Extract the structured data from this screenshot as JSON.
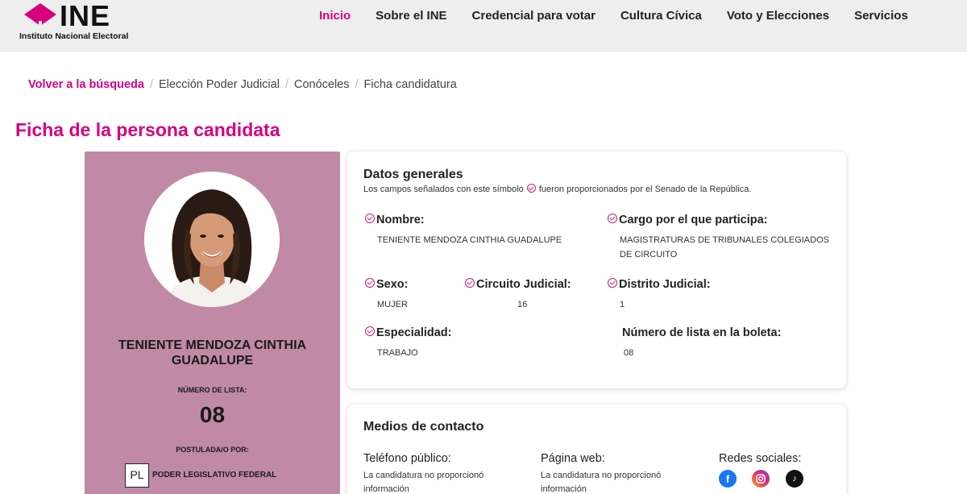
{
  "header": {
    "logo_text": "INE",
    "logo_subtitle": "Instituto Nacional Electoral",
    "nav": [
      "Inicio",
      "Sobre el INE",
      "Credencial para votar",
      "Cultura Cívica",
      "Voto y Elecciones",
      "Servicios"
    ],
    "active_nav": "Inicio"
  },
  "breadcrumb": {
    "back": "Volver a la búsqueda",
    "items": [
      "Elección Poder Judicial",
      "Conóceles",
      "Ficha candidatura"
    ],
    "separator": "/"
  },
  "page_title": "Ficha de la persona candidata",
  "candidate": {
    "name": "TENIENTE MENDOZA CINTHIA GUADALUPE",
    "list_label": "NÚMERO DE LISTA:",
    "list_number": "08",
    "postulated_label": "POSTULADA/O POR:",
    "postulated_code": "PL",
    "postulated_by": "PODER LEGISLATIVO FEDERAL",
    "card_color": "#c08aa7"
  },
  "datos_generales": {
    "title": "Datos generales",
    "note_before": "Los campos señalados con este símbolo",
    "note_after": "fueron proporcionados por el Senado de la República.",
    "nombre_label": "Nombre:",
    "nombre_value": "TENIENTE MENDOZA CINTHIA GUADALUPE",
    "cargo_label": "Cargo por el que participa:",
    "cargo_value": "MAGISTRATURAS DE TRIBUNALES COLEGIADOS DE CIRCUITO",
    "sexo_label": "Sexo:",
    "sexo_value": "MUJER",
    "circuito_label": "Circuito Judicial:",
    "circuito_value": "16",
    "distrito_label": "Distrito Judicial:",
    "distrito_value": "1",
    "especialidad_label": "Especialidad:",
    "especialidad_value": "TRABAJO",
    "numero_lista_label": "Número de lista en la boleta:",
    "numero_lista_value": "08"
  },
  "medios_contacto": {
    "title": "Medios de contacto",
    "telefono_label": "Teléfono público:",
    "telefono_value": "La candidatura no proporcionó información",
    "pagina_label": "Página web:",
    "pagina_value": "La candidatura no proporcionó información",
    "redes_label": "Redes sociales:",
    "social_icons": [
      "facebook-icon",
      "instagram-icon",
      "tiktok-icon"
    ]
  },
  "colors": {
    "brand": "#d6007f",
    "header_bg": "#eeeeee"
  }
}
